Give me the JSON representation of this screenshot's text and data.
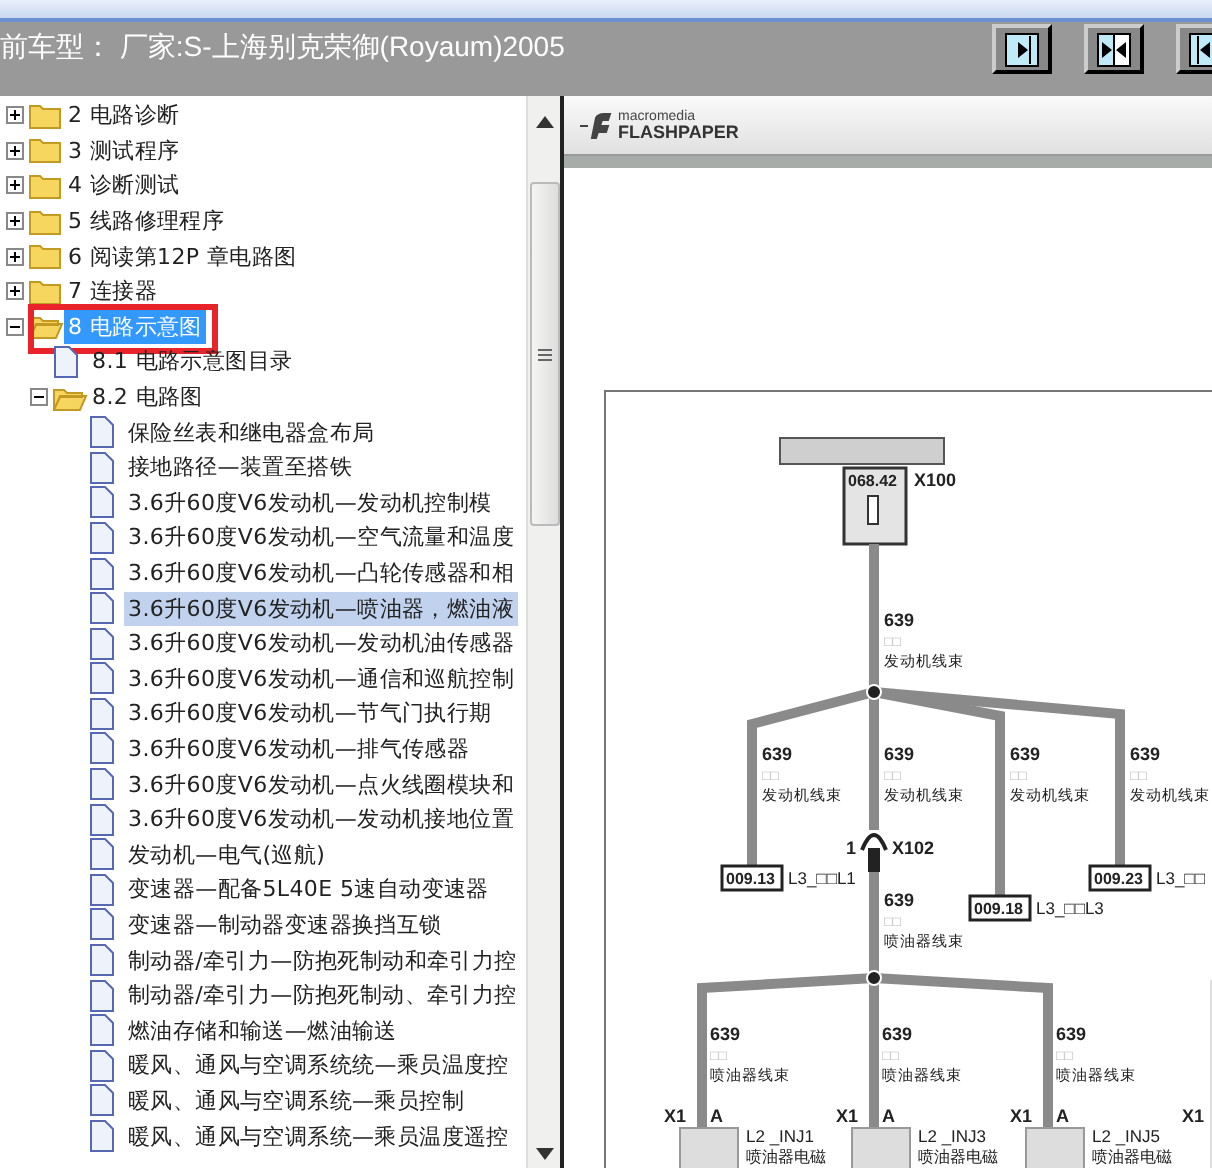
{
  "header": {
    "title": "前车型：  厂家:S-上海别克荣御(Royaum)2005",
    "buttons": [
      {
        "kind": "expand-right"
      },
      {
        "kind": "split"
      },
      {
        "kind": "expand-left"
      }
    ]
  },
  "tree": {
    "items": [
      {
        "label": "2 电路诊断",
        "kind": "folder",
        "expanded": false,
        "selected": false,
        "hovered": false,
        "marked": false
      },
      {
        "label": "3 测试程序",
        "kind": "folder",
        "expanded": false,
        "selected": false,
        "hovered": false,
        "marked": false
      },
      {
        "label": "4 诊断测试",
        "kind": "folder",
        "expanded": false,
        "selected": false,
        "hovered": false,
        "marked": false
      },
      {
        "label": "5 线路修理程序",
        "kind": "folder",
        "expanded": false,
        "selected": false,
        "hovered": false,
        "marked": false
      },
      {
        "label": "6 阅读第12P 章电路图",
        "kind": "folder",
        "expanded": false,
        "selected": false,
        "hovered": false,
        "marked": false
      },
      {
        "label": "7 连接器",
        "kind": "folder",
        "expanded": false,
        "selected": false,
        "hovered": false,
        "marked": false
      },
      {
        "label": "8 电路示意图",
        "kind": "folder",
        "expanded": true,
        "selected": true,
        "hovered": false,
        "marked": true,
        "children": [
          {
            "label": "8.1 电路示意图目录",
            "kind": "document",
            "selected": false,
            "hovered": false,
            "marked": false
          },
          {
            "label": "8.2 电路图",
            "kind": "folder",
            "expanded": true,
            "selected": false,
            "hovered": false,
            "marked": false,
            "children": [
              {
                "label": "保险丝表和继电器盒布局",
                "kind": "document",
                "selected": false,
                "hovered": false,
                "marked": false
              },
              {
                "label": "接地路径—装置至搭铁",
                "kind": "document",
                "selected": false,
                "hovered": false,
                "marked": false
              },
              {
                "label": "3.6升60度V6发动机—发动机控制模",
                "kind": "document",
                "selected": false,
                "hovered": false,
                "marked": false
              },
              {
                "label": "3.6升60度V6发动机—空气流量和温度",
                "kind": "document",
                "selected": false,
                "hovered": false,
                "marked": false
              },
              {
                "label": "3.6升60度V6发动机—凸轮传感器和相",
                "kind": "document",
                "selected": false,
                "hovered": false,
                "marked": false
              },
              {
                "label": "3.6升60度V6发动机—喷油器，燃油液",
                "kind": "document",
                "selected": false,
                "hovered": true,
                "marked": false
              },
              {
                "label": "3.6升60度V6发动机—发动机油传感器",
                "kind": "document",
                "selected": false,
                "hovered": false,
                "marked": false
              },
              {
                "label": "3.6升60度V6发动机—通信和巡航控制",
                "kind": "document",
                "selected": false,
                "hovered": false,
                "marked": false
              },
              {
                "label": "3.6升60度V6发动机—节气门执行期",
                "kind": "document",
                "selected": false,
                "hovered": false,
                "marked": false
              },
              {
                "label": "3.6升60度V6发动机—排气传感器",
                "kind": "document",
                "selected": false,
                "hovered": false,
                "marked": false
              },
              {
                "label": "3.6升60度V6发动机—点火线圈模块和",
                "kind": "document",
                "selected": false,
                "hovered": false,
                "marked": false
              },
              {
                "label": "3.6升60度V6发动机—发动机接地位置",
                "kind": "document",
                "selected": false,
                "hovered": false,
                "marked": false
              },
              {
                "label": "发动机—电气(巡航)",
                "kind": "document",
                "selected": false,
                "hovered": false,
                "marked": false
              },
              {
                "label": "变速器—配备5L40E 5速自动变速器",
                "kind": "document",
                "selected": false,
                "hovered": false,
                "marked": false
              },
              {
                "label": "变速器—制动器变速器换挡互锁",
                "kind": "document",
                "selected": false,
                "hovered": false,
                "marked": false
              },
              {
                "label": "制动器/牵引力—防抱死制动和牵引力控",
                "kind": "document",
                "selected": false,
                "hovered": false,
                "marked": false
              },
              {
                "label": "制动器/牵引力—防抱死制动、牵引力控",
                "kind": "document",
                "selected": false,
                "hovered": false,
                "marked": false
              },
              {
                "label": "燃油存储和输送—燃油输送",
                "kind": "document",
                "selected": false,
                "hovered": false,
                "marked": false
              },
              {
                "label": "暖风、通风与空调系统统—乘员温度控",
                "kind": "document",
                "selected": false,
                "hovered": false,
                "marked": false
              },
              {
                "label": "暖风、通风与空调系统—乘员控制",
                "kind": "document",
                "selected": false,
                "hovered": false,
                "marked": false
              },
              {
                "label": "暖风、通风与空调系统—乘员温度遥控",
                "kind": "document",
                "selected": false,
                "hovered": false,
                "marked": false
              }
            ]
          }
        ]
      }
    ]
  },
  "viewer": {
    "brand_top": "macromedia",
    "brand_bottom": "FLASHPAPER",
    "diagram": {
      "fuse_code": "068.42",
      "fuse_connector": "X100",
      "feed_wire": {
        "number": "639",
        "color_code": "□□",
        "harness": "发动机线束"
      },
      "branches": [
        {
          "number": "639",
          "color_code": "□□",
          "harness": "发动机线束",
          "splice": "009.13",
          "pin": "L3_□□L1"
        },
        {
          "number": "639",
          "color_code": "□□",
          "harness": "发动机线束",
          "jumper_pin": "1",
          "jumper_connector": "X102"
        },
        {
          "number": "639",
          "color_code": "□□",
          "harness": "发动机线束",
          "splice": "009.18",
          "pin": "L3_□□L3"
        },
        {
          "number": "639",
          "color_code": "□□",
          "harness": "发动机线束",
          "splice": "009.23",
          "pin": "L3_□□"
        }
      ],
      "injector_wire": {
        "number": "639",
        "color_code": "□□",
        "harness": "喷油器线束"
      },
      "injectors": [
        {
          "number": "639",
          "color_code": "□□",
          "harness": "喷油器线束",
          "connector": "X1",
          "pin": "A",
          "name": "L2 _INJ1",
          "desc": "喷油器电磁"
        },
        {
          "number": "639",
          "color_code": "□□",
          "harness": "喷油器线束",
          "connector": "X1",
          "pin": "A",
          "name": "L2 _INJ3",
          "desc": "喷油器电磁"
        },
        {
          "number": "639",
          "color_code": "□□",
          "harness": "喷油器线束",
          "connector": "X1",
          "pin": "A",
          "name": "L2 _INJ5",
          "desc": "喷油器电磁"
        }
      ],
      "edge_connector": "X1"
    }
  }
}
